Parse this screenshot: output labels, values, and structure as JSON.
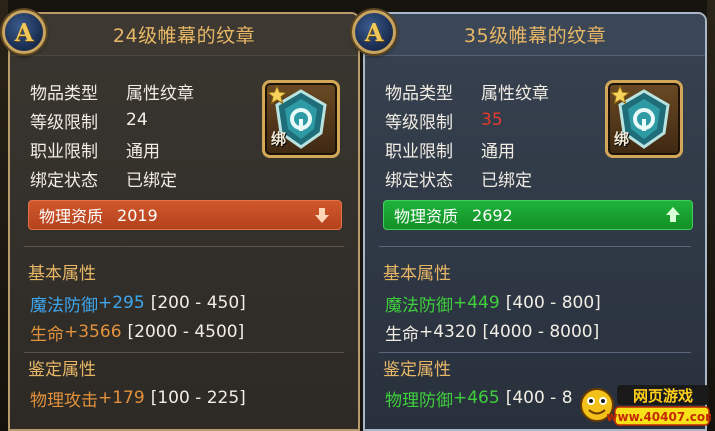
{
  "panels": [
    {
      "badge_letter": "A",
      "title": "24级帷幕的纹章",
      "info": [
        {
          "label": "物品类型",
          "value": "属性纹章"
        },
        {
          "label": "等级限制",
          "value": "24"
        },
        {
          "label": "职业限制",
          "value": "通用"
        },
        {
          "label": "绑定状态",
          "value": "已绑定"
        }
      ],
      "icon": {
        "name": "shield-emblem-icon",
        "bound_label": "绑",
        "star": "star-icon"
      },
      "stat_bar": {
        "label": "物理资质",
        "value": "2019",
        "arrow": "arrow-down-icon",
        "color": "#c84b24"
      },
      "basic_title": "基本属性",
      "basic_attrs": [
        {
          "name": "魔法防御",
          "bonus": "+295",
          "range": "[200 - 450]",
          "color": "blue"
        },
        {
          "name": "生命",
          "bonus": "+3566",
          "range": "[2000 - 4500]",
          "color": "orange"
        }
      ],
      "appraise_title": "鉴定属性",
      "appraise_attrs": [
        {
          "name": "物理攻击",
          "bonus": "+179",
          "range": "[100 - 225]",
          "color": "orange"
        }
      ]
    },
    {
      "badge_letter": "A",
      "title": "35级帷幕的纹章",
      "info": [
        {
          "label": "物品类型",
          "value": "属性纹章"
        },
        {
          "label": "等级限制",
          "value": "35",
          "warn": true
        },
        {
          "label": "职业限制",
          "value": "通用"
        },
        {
          "label": "绑定状态",
          "value": "已绑定"
        }
      ],
      "icon": {
        "name": "shield-emblem-icon",
        "bound_label": "绑",
        "star": "star-icon"
      },
      "stat_bar": {
        "label": "物理资质",
        "value": "2692",
        "arrow": "arrow-up-icon",
        "color": "#1ca636"
      },
      "basic_title": "基本属性",
      "basic_attrs": [
        {
          "name": "魔法防御",
          "bonus": "+449",
          "range": "[400 - 800]",
          "color": "green"
        },
        {
          "name": "生命",
          "bonus": "+4320",
          "range": "[4000 - 8000]",
          "color": "white"
        }
      ],
      "appraise_title": "鉴定属性",
      "appraise_attrs": [
        {
          "name": "物理防御",
          "bonus": "+465",
          "range": "[400 - 8",
          "color": "green"
        }
      ]
    }
  ],
  "watermark": {
    "title": "网页游戏",
    "url": "www.40407.com",
    "icon": "mascot-logo-icon"
  }
}
